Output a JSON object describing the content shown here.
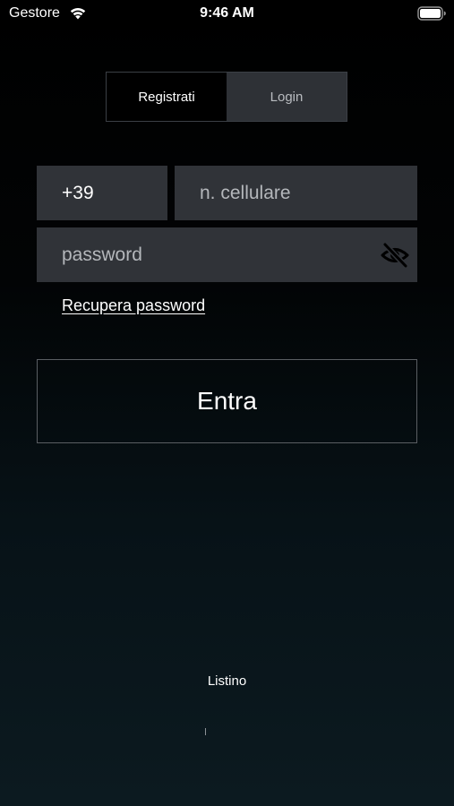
{
  "status_bar": {
    "carrier": "Gestore",
    "time": "9:46 AM",
    "wifi_icon": "wifi-icon",
    "battery_icon": "battery-icon"
  },
  "auth_tabs": {
    "register_label": "Registrati",
    "login_label": "Login",
    "selected": "Registrati"
  },
  "form": {
    "country_code": "+39",
    "phone_placeholder": "n. cellulare",
    "password_placeholder": "password",
    "visibility_icon": "eye-off-icon",
    "recover_password_label": "Recupera password",
    "submit_label": "Entra"
  },
  "footer": {
    "price_list_label": "Listino"
  },
  "colors": {
    "field_background": "#303338",
    "placeholder": "#b4b7bb",
    "button_border": "#5a5e63",
    "background_top": "#000000",
    "background_bottom": "#0c1a20"
  }
}
